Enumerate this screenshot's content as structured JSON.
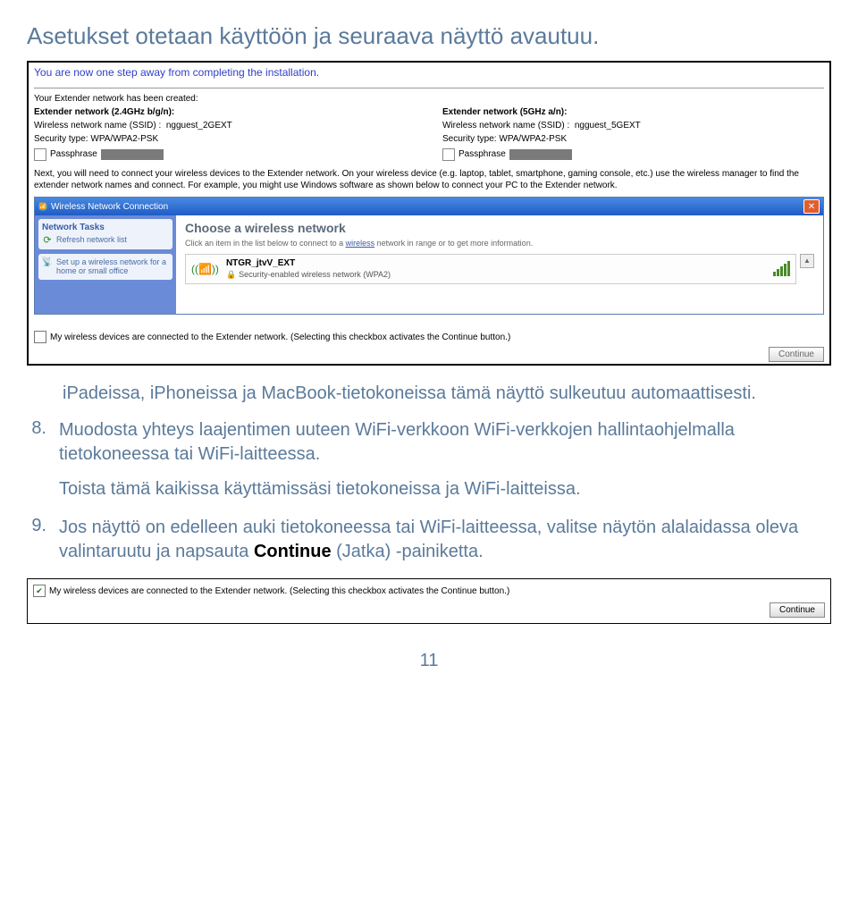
{
  "title": "Asetukset otetaan käyttöön ja seuraava näyttö avautuu.",
  "screenshot1": {
    "header": "You are now one step away from completing the installation.",
    "created": "Your Extender network has been created:",
    "net24": {
      "heading": "Extender network (2.4GHz b/g/n):",
      "ssid_label": "Wireless network name (SSID) :",
      "ssid": "ngguest_2GEXT",
      "sec_label": "Security type:",
      "sec": "WPA/WPA2-PSK",
      "pp": "Passphrase"
    },
    "net5": {
      "heading": "Extender network (5GHz a/n):",
      "ssid_label": "Wireless network name (SSID) :",
      "ssid": "ngguest_5GEXT",
      "sec_label": "Security type:",
      "sec": "WPA/WPA2-PSK",
      "pp": "Passphrase"
    },
    "instructions": "Next, you will need to connect your wireless devices to the Extender network. On your wireless device (e.g. laptop, tablet, smartphone, gaming console, etc.) use the wireless manager to find the extender network names and connect. For example, you might use Windows software as shown below to connect your PC to the Extender network.",
    "win": {
      "title": "Wireless Network Connection",
      "tasks_h": "Network Tasks",
      "refresh": "Refresh network list",
      "setup": "Set up a wireless network for a home or small office",
      "choose": "Choose a wireless network",
      "sub_a": "Click an item in the list below to connect to a ",
      "sub_link": "wireless",
      "sub_b": " network in range or to get more information.",
      "net_name": "NTGR_jtvV_EXT",
      "net_sec": "Security-enabled wireless network (WPA2)"
    },
    "cb_text": "My wireless devices are connected to the Extender network. (Selecting this checkbox activates the Continue button.)",
    "continue": "Continue"
  },
  "below": "iPadeissa, iPhoneissa ja MacBook-tietokoneissa tämä näyttö sulkeutuu automaattisesti.",
  "item8": {
    "num": "8.",
    "p1": "Muodosta yhteys laajentimen uuteen WiFi-verkkoon WiFi-verkkojen hallintaohjelmalla tietokoneessa tai WiFi-laitteessa.",
    "p2": "Toista tämä kaikissa käyttämissäsi tietokoneissa ja WiFi-laitteissa."
  },
  "item9": {
    "num": "9.",
    "p1a": "Jos näyttö on edelleen auki tietokoneessa tai WiFi-laitteessa, valitse näytön alalaidassa oleva valintaruutu ja napsauta ",
    "p1b": "Continue",
    "p1c": " (Jatka) -painiketta."
  },
  "screenshot2": {
    "cb_text": "My wireless devices are connected to the Extender network. (Selecting this checkbox activates the Continue button.)",
    "continue": "Continue"
  },
  "page": "11"
}
